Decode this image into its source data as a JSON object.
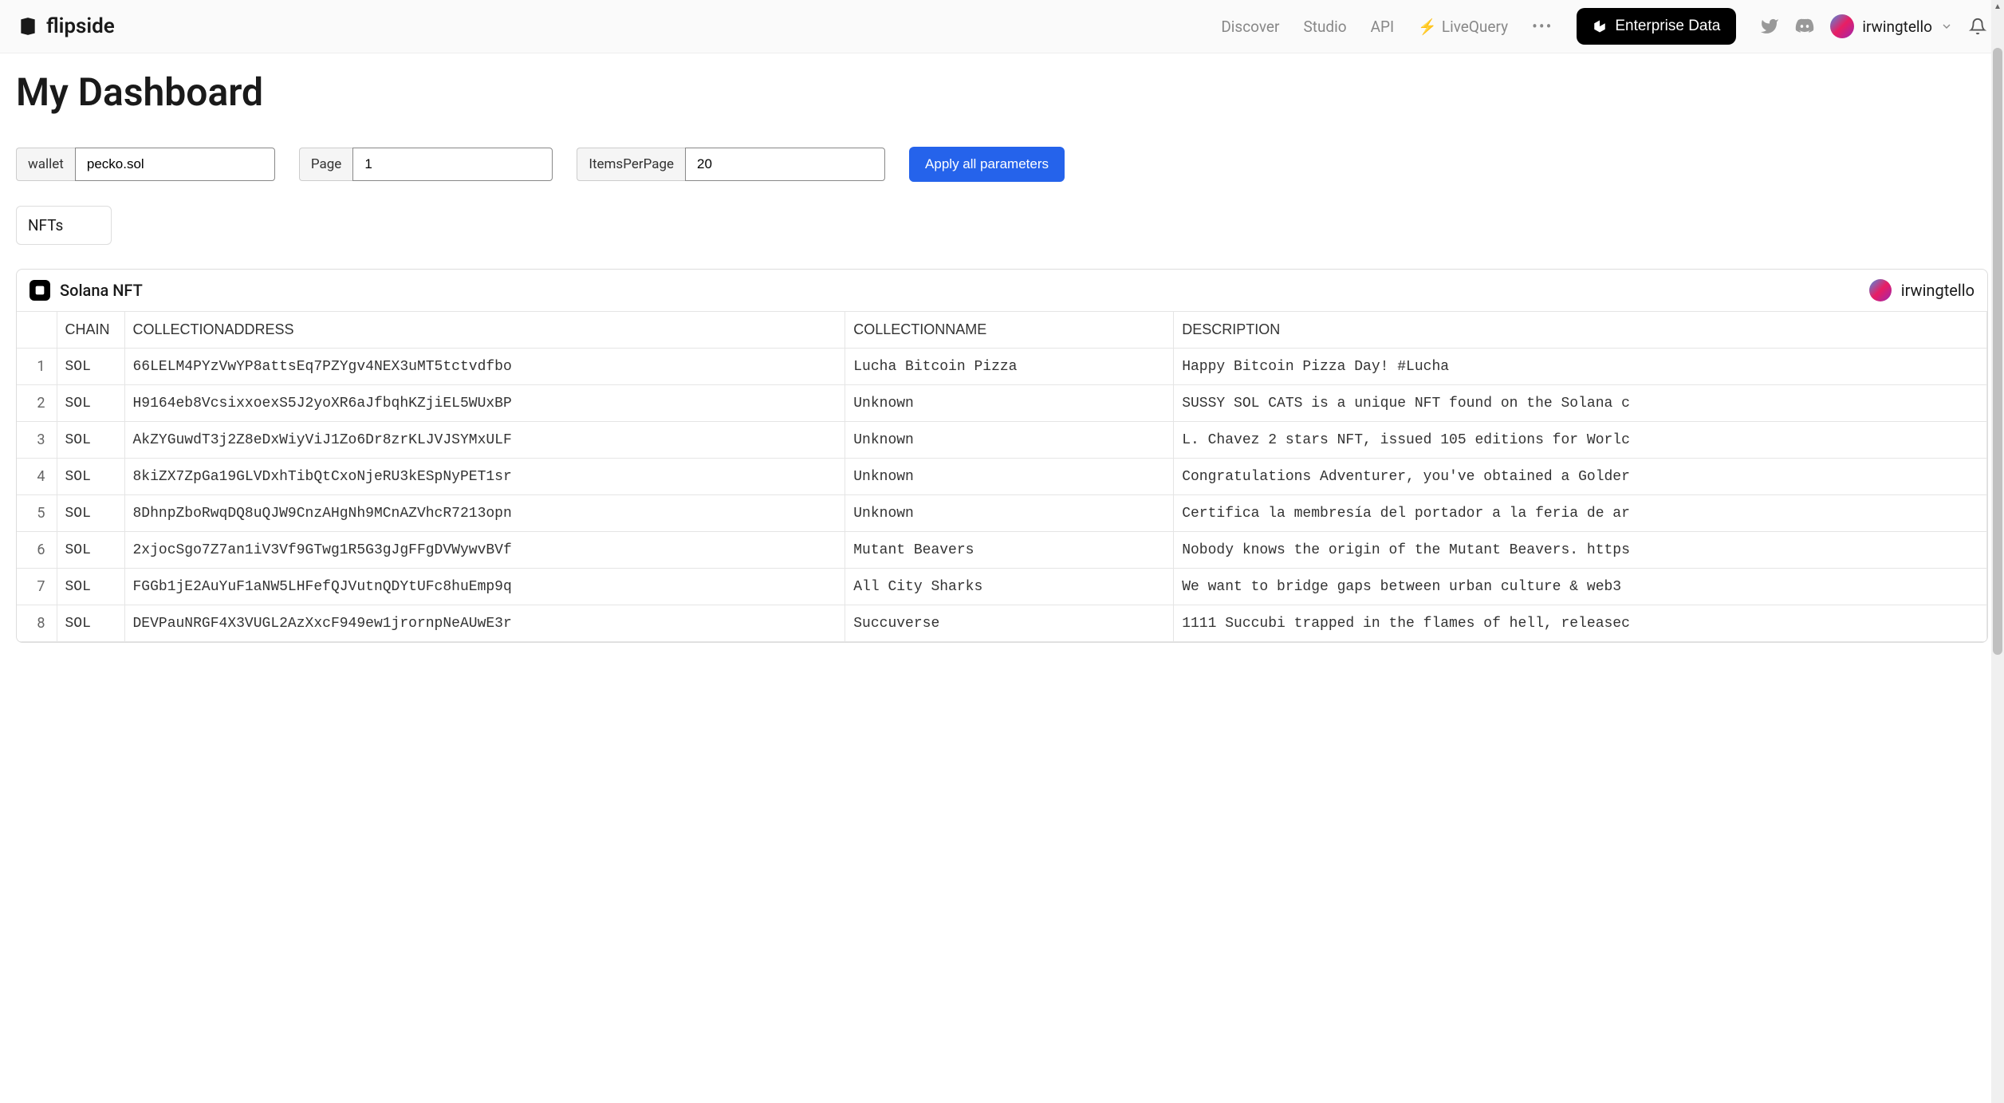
{
  "brand": "flipside",
  "nav": {
    "discover": "Discover",
    "studio": "Studio",
    "api": "API",
    "livequery": "LiveQuery"
  },
  "enterprise_label": "Enterprise Data",
  "username": "irwingtello",
  "page_title": "My Dashboard",
  "params": {
    "wallet": {
      "label": "wallet",
      "value": "pecko.sol"
    },
    "page": {
      "label": "Page",
      "value": "1"
    },
    "items_per_page": {
      "label": "ItemsPerPage",
      "value": "20"
    }
  },
  "apply_label": "Apply all parameters",
  "tabs": {
    "nfts": "NFTs"
  },
  "panel": {
    "title": "Solana NFT",
    "author": "irwingtello",
    "columns": {
      "chain": "CHAIN",
      "collection_address": "COLLECTIONADDRESS",
      "collection_name": "COLLECTIONNAME",
      "description": "DESCRIPTION"
    },
    "rows": [
      {
        "idx": "1",
        "chain": "SOL",
        "addr": "66LELM4PYzVwYP8attsEq7PZYgv4NEX3uMT5tctvdfbo",
        "coll": "Lucha Bitcoin Pizza",
        "desc": "Happy Bitcoin Pizza Day! #Lucha"
      },
      {
        "idx": "2",
        "chain": "SOL",
        "addr": "H9164eb8VcsixxoexS5J2yoXR6aJfbqhKZjiEL5WUxBP",
        "coll": "Unknown",
        "desc": "SUSSY SOL CATS is a unique NFT found on the Solana c"
      },
      {
        "idx": "3",
        "chain": "SOL",
        "addr": "AkZYGuwdT3j2Z8eDxWiyViJ1Zo6Dr8zrKLJVJSYMxULF",
        "coll": "Unknown",
        "desc": "L. Chavez 2 stars NFT, issued 105 editions for Worlc"
      },
      {
        "idx": "4",
        "chain": "SOL",
        "addr": "8kiZX7ZpGa19GLVDxhTibQtCxoNjeRU3kESpNyPET1sr",
        "coll": "Unknown",
        "desc": "Congratulations Adventurer, you've obtained a Golder"
      },
      {
        "idx": "5",
        "chain": "SOL",
        "addr": "8DhnpZboRwqDQ8uQJW9CnzAHgNh9MCnAZVhcR7213opn",
        "coll": "Unknown",
        "desc": "Certifica la membresía del portador a la feria de ar"
      },
      {
        "idx": "6",
        "chain": "SOL",
        "addr": "2xjocSgo7Z7an1iV3Vf9GTwg1R5G3gJgFFgDVWywvBVf",
        "coll": "Mutant Beavers",
        "desc": "Nobody knows the origin of the Mutant Beavers. https"
      },
      {
        "idx": "7",
        "chain": "SOL",
        "addr": "FGGb1jE2AuYuF1aNW5LHFefQJVutnQDYtUFc8huEmp9q",
        "coll": "All City Sharks",
        "desc": "We want to bridge gaps between urban culture & web3"
      },
      {
        "idx": "8",
        "chain": "SOL",
        "addr": "DEVPauNRGF4X3VUGL2AzXxcF949ew1jrornpNeAUwE3r",
        "coll": "Succuverse",
        "desc": "1111 Succubi trapped in the flames of hell, releasec"
      }
    ]
  }
}
